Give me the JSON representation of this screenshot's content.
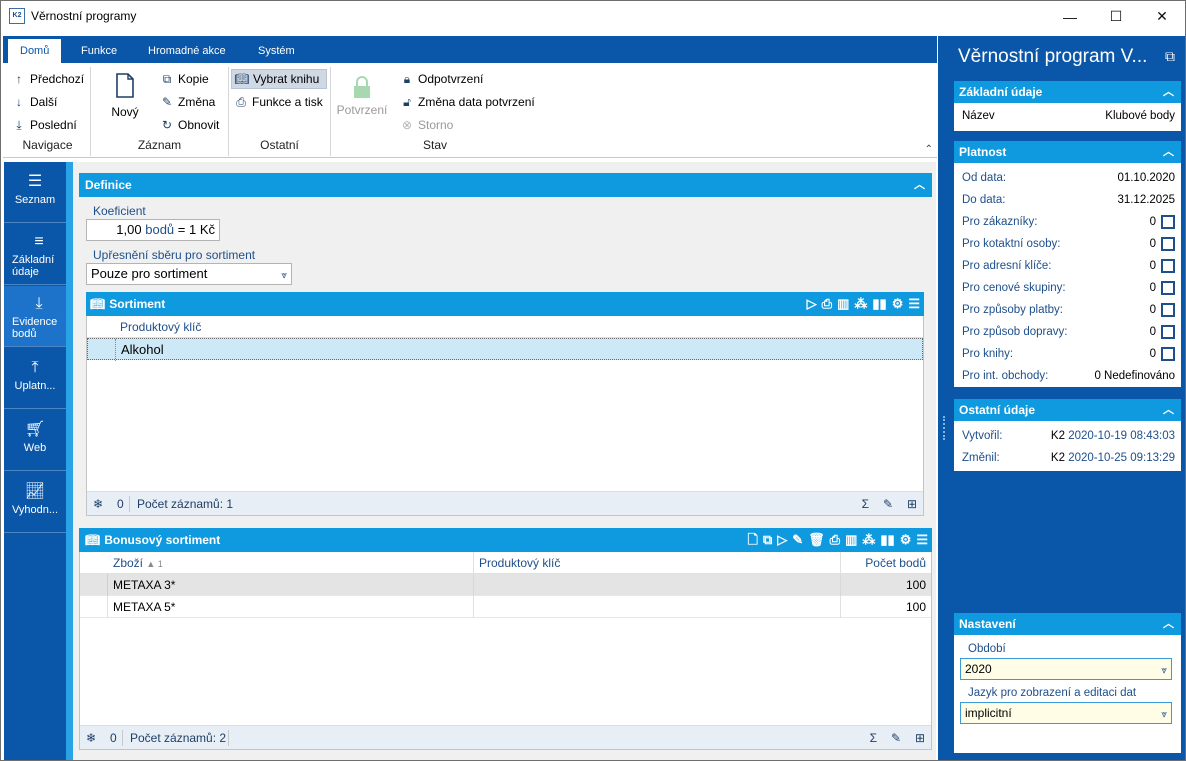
{
  "window": {
    "title": "Věrnostní programy",
    "minimize": "—",
    "maximize": "☐",
    "close": "✕",
    "logo": "K2"
  },
  "ribbon": {
    "tabs": [
      "Domů",
      "Funkce",
      "Hromadné akce",
      "Systém"
    ],
    "navigation": {
      "label": "Navigace",
      "prev": "Předchozí",
      "next": "Další",
      "last": "Poslední"
    },
    "record": {
      "label": "Záznam",
      "new": "Nový",
      "copy": "Kopie",
      "change": "Změna",
      "refresh": "Obnovit"
    },
    "other": {
      "label": "Ostatní",
      "choose_book": "Vybrat knihu",
      "functions_print": "Funkce a tisk"
    },
    "state": {
      "label": "Stav",
      "confirm": "Potvrzení",
      "unconfirm": "Odpotvrzení",
      "change_date": "Změna data potvrzení",
      "cancel": "Storno"
    }
  },
  "leftnav": [
    {
      "label": "Seznam",
      "icon": "hamburger-icon"
    },
    {
      "label": "Základní údaje",
      "icon": "list-icon"
    },
    {
      "label": "Evidence bodů",
      "icon": "download-icon"
    },
    {
      "label": "Uplatn...",
      "icon": "upload-icon"
    },
    {
      "label": "Web",
      "icon": "cart-icon"
    },
    {
      "label": "Vyhodn...",
      "icon": "chart-icon"
    }
  ],
  "definition": {
    "title": "Definice",
    "coef_label": "Koeficient",
    "coef_num": "1,00",
    "coef_unit": "bodů",
    "coef_rest": "= 1 Kč",
    "refine_label": "Upřesnění sběru pro sortiment",
    "refine_value": "Pouze pro sortiment"
  },
  "sortiment": {
    "title": "Sortiment",
    "columns": [
      "Produktový klíč"
    ],
    "rows": [
      [
        "Alkohol"
      ]
    ],
    "footer_count": "0",
    "footer_text": "Počet záznamů: 1"
  },
  "bonus": {
    "title": "Bonusový sortiment",
    "columns": [
      "Zboží",
      "Produktový klíč",
      "Počet bodů"
    ],
    "sort_indicator": "▲ 1",
    "rows": [
      [
        "METAXA 3*",
        "",
        "100"
      ],
      [
        "METAXA 5*",
        "",
        "100"
      ]
    ],
    "footer_count": "0",
    "footer_text": "Počet záznamů: 2"
  },
  "rightpane": {
    "title": "Věrnostní program V...",
    "basic": {
      "title": "Základní údaje",
      "name_label": "Název",
      "name_value": "Klubové body"
    },
    "validity": {
      "title": "Platnost",
      "from_label": "Od data:",
      "from_value": "01.10.2020",
      "to_label": "Do data:",
      "to_value": "31.12.2025",
      "items": [
        {
          "label": "Pro zákazníky:",
          "value": "0"
        },
        {
          "label": "Pro kotaktní osoby:",
          "value": "0"
        },
        {
          "label": "Pro adresní klíče:",
          "value": "0"
        },
        {
          "label": "Pro cenové skupiny:",
          "value": "0"
        },
        {
          "label": "Pro způsoby platby:",
          "value": "0"
        },
        {
          "label": "Pro způsob dopravy:",
          "value": "0"
        },
        {
          "label": "Pro knihy:",
          "value": "0"
        }
      ],
      "int_label": "Pro int. obchody:",
      "int_value": "0 Nedefinováno"
    },
    "other": {
      "title": "Ostatní údaje",
      "created_label": "Vytvořil:",
      "created_user": "K2",
      "created_date": "2020-10-19 08:43:03",
      "changed_label": "Změnil:",
      "changed_user": "K2",
      "changed_date": "2020-10-25 09:13:29"
    },
    "settings": {
      "title": "Nastavení",
      "period_label": "Období",
      "period_value": "2020",
      "lang_label": "Jazyk pro zobrazení a editaci dat",
      "lang_value": "implicitní"
    }
  }
}
